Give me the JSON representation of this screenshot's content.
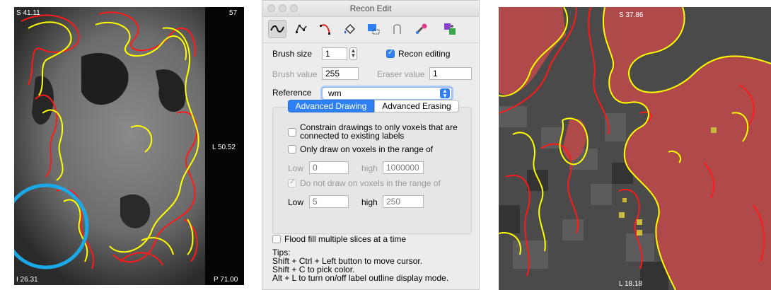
{
  "left_view": {
    "top_left": "S 41.11",
    "top_right": "57",
    "right": "L 50.52",
    "bottom_left": "I 26.31",
    "bottom_right": "P 71.00"
  },
  "dialog": {
    "title": "Recon Edit",
    "tools": [
      {
        "icon": "freehand-icon",
        "active": true
      },
      {
        "icon": "polyline-icon",
        "active": false
      },
      {
        "icon": "livewire-icon",
        "active": false
      },
      {
        "icon": "fill-icon",
        "active": false
      },
      {
        "icon": "contour-icon",
        "active": false
      },
      {
        "icon": "color-picker-icon",
        "active": false
      },
      {
        "icon": "eyedropper-icon",
        "active": false
      },
      {
        "icon": "clone-icon",
        "active": false
      }
    ],
    "brush_size_label": "Brush size",
    "brush_size_value": "1",
    "recon_editing_label": "Recon editing",
    "recon_editing_checked": true,
    "brush_value_label": "Brush value",
    "brush_value": "255",
    "eraser_value_label": "Eraser value",
    "eraser_value": "1",
    "reference_label": "Reference",
    "reference_value": "wm",
    "tabs": [
      "Advanced Drawing",
      "Advanced Erasing"
    ],
    "active_tab": "Advanced Drawing",
    "constrain_label": "Constrain drawings to only voxels that are connected to existing labels",
    "constrain_line1": "Constrain drawings to only voxels that are",
    "constrain_line2": "connected to existing labels",
    "only_draw_label": "Only draw on voxels in the range of",
    "range1": {
      "low_label": "Low",
      "low": "0",
      "high_label": "high",
      "high": "1000000"
    },
    "do_not_draw_label": "Do not draw on voxels in the range of",
    "range2": {
      "low_label": "Low",
      "low": "5",
      "high_label": "high",
      "high": "250"
    },
    "flood_fill_label": "Flood fill multiple slices at a time",
    "tips": [
      "Tips:",
      "Shift + Ctrl + Left button to move cursor.",
      "Shift + C to pick color.",
      "Alt + L to turn on/off label outline display mode."
    ]
  },
  "right_view": {
    "top": "S 37.86",
    "bottom": "L 18.18"
  },
  "colors": {
    "white_matter_outline": "#ffff00",
    "pial_outline": "#ff1a1a",
    "label_overlay": "#b84a4a",
    "highlight_circle": "#1aa9e6",
    "accent_blue": "#2f7ff5"
  }
}
